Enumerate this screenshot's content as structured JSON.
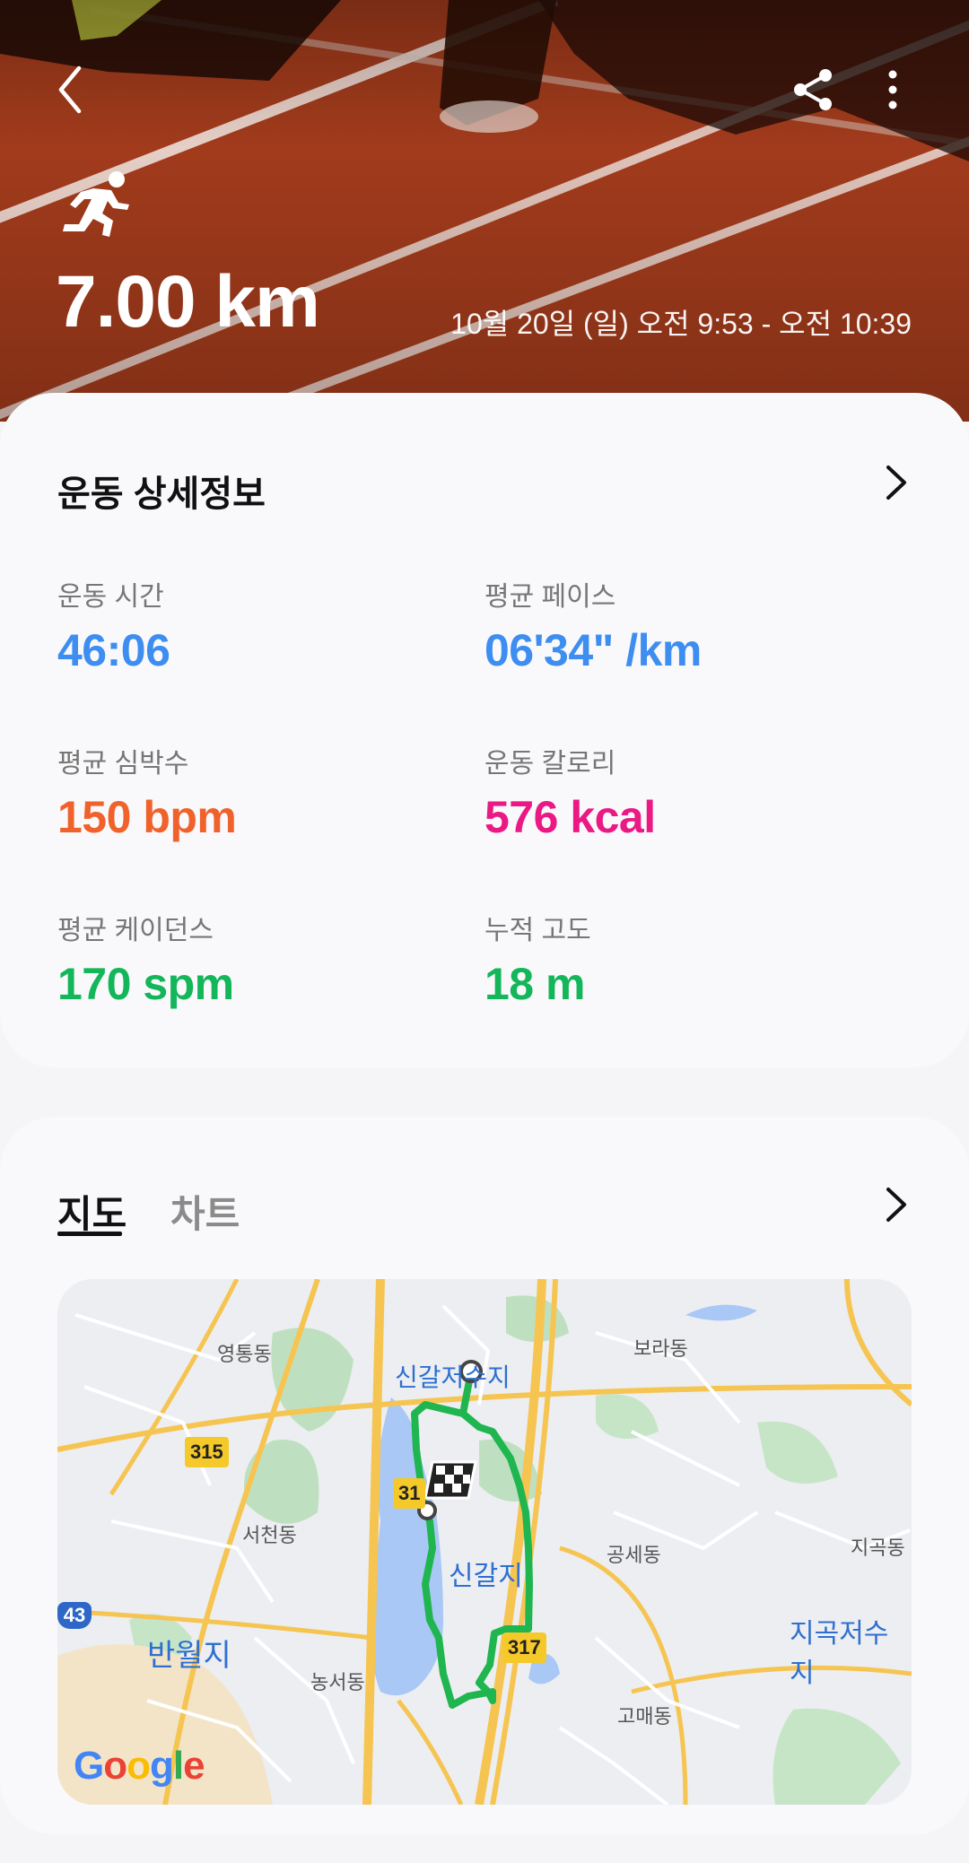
{
  "header": {
    "distance": "7.00 km",
    "datetime": "10월 20일 (일) 오전 9:53 - 오전 10:39"
  },
  "details": {
    "title": "운동 상세정보",
    "metrics": [
      {
        "label": "운동 시간",
        "value": "46:06",
        "color": "#3d8ef0"
      },
      {
        "label": "평균 페이스",
        "value": "06'34\" /km",
        "color": "#3d8ef0"
      },
      {
        "label": "평균 심박수",
        "value": "150 bpm",
        "color": "#f0622c"
      },
      {
        "label": "운동 칼로리",
        "value": "576 kcal",
        "color": "#ea1983"
      },
      {
        "label": "평균 케이던스",
        "value": "170 spm",
        "color": "#14b65a"
      },
      {
        "label": "누적 고도",
        "value": "18 m",
        "color": "#14b65a"
      }
    ]
  },
  "map_section": {
    "tabs": [
      {
        "label": "지도",
        "active": true
      },
      {
        "label": "차트",
        "active": false
      }
    ],
    "map": {
      "labels": {
        "youngtong": "영통동",
        "boradong": "보라동",
        "singal_reservoir_top": "신갈저수지",
        "seocheon": "서천동",
        "gongse": "공세동",
        "jigok": "지곡동",
        "singalji": "신갈지",
        "jigok_reservoir": "지곡저수지",
        "banwolji": "반월지",
        "nongseo": "농서동",
        "gomae": "고매동"
      },
      "badges": {
        "r315": "315",
        "r31x": "31",
        "r317": "317",
        "h43": "43"
      },
      "route_color": "#1fb54f"
    },
    "google": [
      "G",
      "o",
      "o",
      "g",
      "l",
      "e"
    ]
  }
}
